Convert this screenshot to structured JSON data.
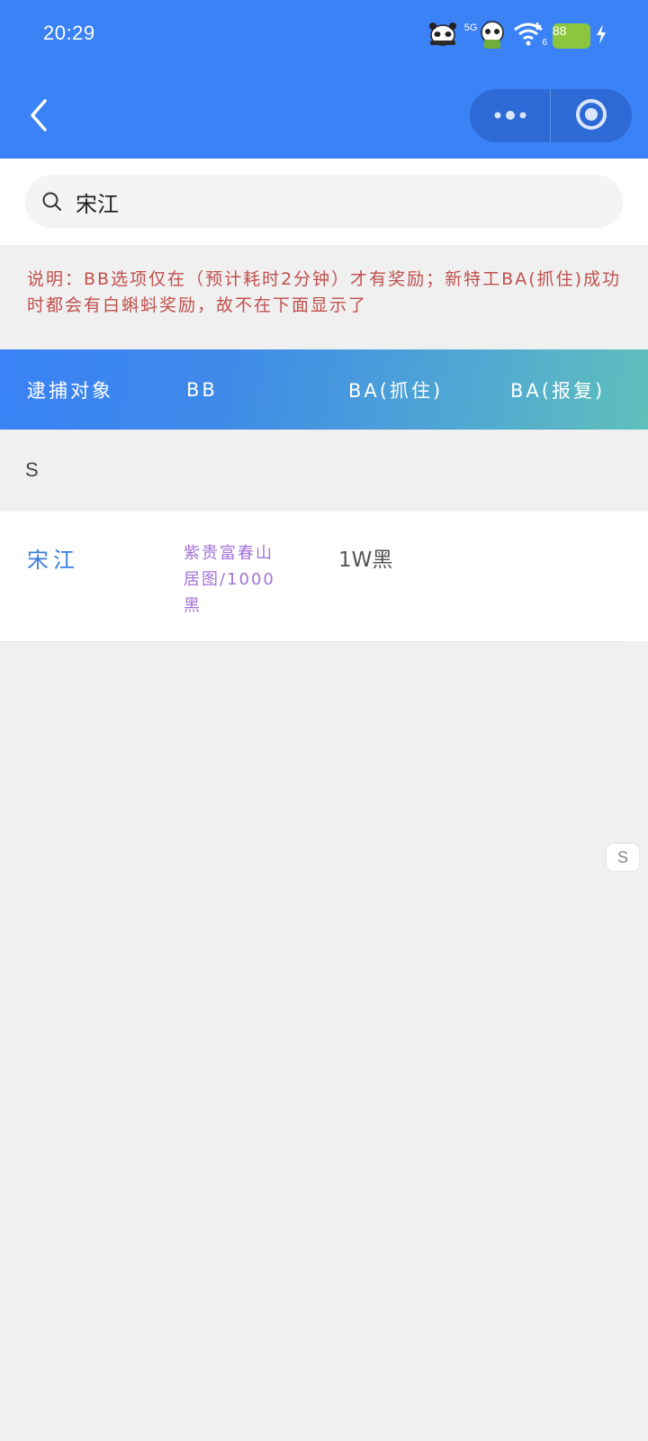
{
  "status_bar": {
    "time": "20:29",
    "network_label": "5G",
    "wifi_label": "6",
    "battery_level": "88",
    "icons": [
      "panda-sticker-icon",
      "panda-sticker-icon",
      "signal-icon",
      "wifi-icon",
      "battery-icon",
      "charging-icon"
    ]
  },
  "nav": {
    "back_icon": "chevron-left-icon",
    "more_icon": "more-dots-icon",
    "close_icon": "target-circle-icon"
  },
  "search": {
    "value": "宋江",
    "icon": "search-icon"
  },
  "notice": "说明：BB选项仅在（预计耗时2分钟）才有奖励；新特工BA(抓住)成功时都会有白蝌蚪奖励，故不在下面显示了",
  "table": {
    "headers": [
      "逮捕对象",
      "BB",
      "BA(抓住)",
      "BA(报复)"
    ],
    "groups": [
      {
        "letter": "S",
        "rows": [
          {
            "name": "宋江",
            "bb": "紫贵富春山居图/1000黑",
            "ba_catch": "1W黑",
            "ba_revenge": ""
          }
        ]
      }
    ]
  },
  "index_bar": {
    "letter": "S"
  },
  "colors": {
    "primary": "#3a82f6",
    "capsule": "#2d6ad6",
    "notice_text": "#c0504d",
    "name_text": "#3a7ee0",
    "bb_text": "#a373d8",
    "header_gradient_end": "#5fc0bb",
    "background": "#f0f0f0"
  }
}
